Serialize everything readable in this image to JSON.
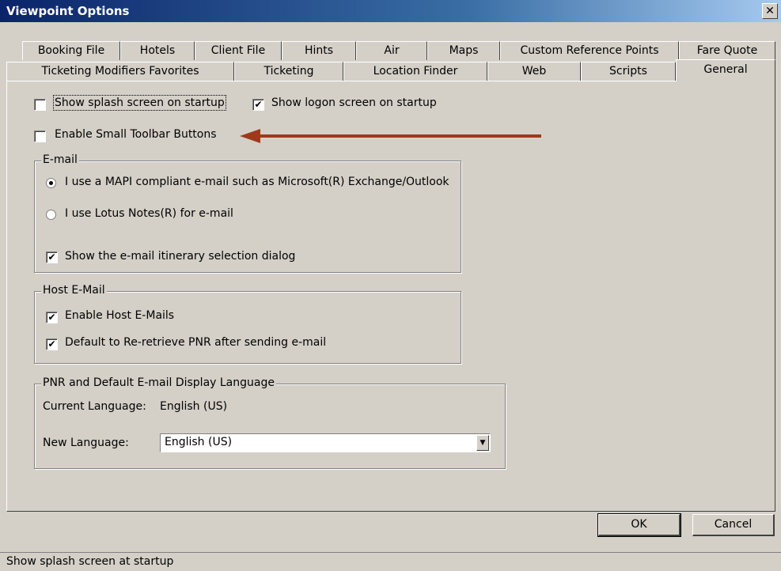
{
  "window": {
    "title": "Viewpoint Options",
    "close_glyph": "✕"
  },
  "tabs_row1": [
    "Booking File",
    "Hotels",
    "Client File",
    "Hints",
    "Air",
    "Maps",
    "Custom Reference Points",
    "Fare Quote"
  ],
  "tabs_row2": [
    "Ticketing Modifiers Favorites",
    "Ticketing",
    "Location Finder",
    "Web",
    "Scripts",
    "General"
  ],
  "active_tab": "General",
  "general": {
    "show_splash": {
      "label": "Show splash screen on startup",
      "checked": false
    },
    "show_logon": {
      "label": "Show logon screen on startup",
      "checked": true
    },
    "small_toolbar": {
      "label": "Enable Small Toolbar Buttons",
      "checked": false
    },
    "arrow_color": "#9e3a1a"
  },
  "email_group": {
    "legend": "E-mail",
    "mapi_label": "I use a  MAPI compliant e-mail such as Microsoft(R) Exchange/Outlook",
    "mapi_selected": true,
    "lotus_label": "I use Lotus Notes(R) for e-mail",
    "lotus_selected": false,
    "itinerary_label": "Show the e-mail itinerary selection dialog",
    "itinerary_checked": true
  },
  "host_email_group": {
    "legend": "Host E-Mail",
    "enable_label": "Enable Host E-Mails",
    "enable_checked": true,
    "reretrieve_label": "Default to Re-retrieve PNR after sending e-mail",
    "reretrieve_checked": true
  },
  "language_group": {
    "legend": "PNR and Default E-mail Display Language",
    "current_label": "Current Language:",
    "current_value": "English (US)",
    "new_label": "New Language:",
    "new_value": "English (US)"
  },
  "buttons": {
    "ok": "OK",
    "cancel": "Cancel"
  },
  "status": {
    "text": "Show splash screen at startup"
  },
  "check_glyph": "✔"
}
